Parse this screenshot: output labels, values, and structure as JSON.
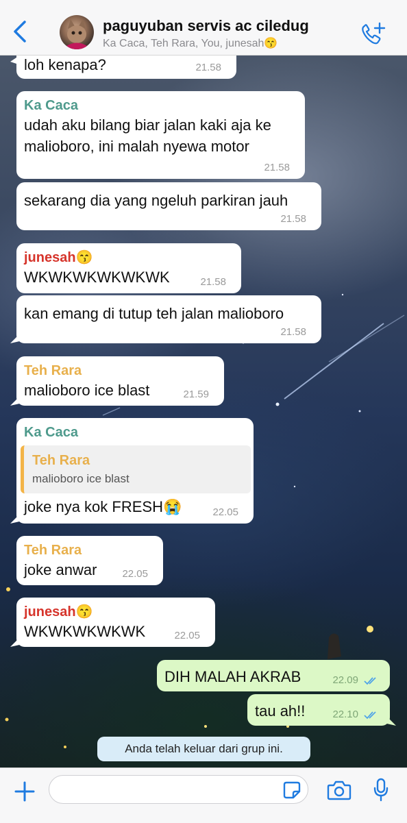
{
  "header": {
    "group_name": "paguyuban servis ac ciledug",
    "members": "Ka Caca, Teh Rara, You, junesah😙"
  },
  "colors": {
    "accent": "#1f7be0",
    "sender_ka_caca": "#4e9a8c",
    "sender_teh_rara": "#e8b04c",
    "sender_junesah": "#d6342b",
    "outgoing_bubble": "#dcf8c6"
  },
  "messages": [
    {
      "text": "loh kenapa?",
      "time": "21.58"
    },
    {
      "sender": "Ka Caca",
      "text": "udah aku bilang biar jalan kaki aja ke malioboro, ini malah nyewa motor",
      "time": "21.58"
    },
    {
      "text": "sekarang dia yang ngeluh parkiran jauh",
      "time": "21.58"
    },
    {
      "sender": "junesah😙",
      "text": "WKWKWKWKWKWK",
      "time": "21.58"
    },
    {
      "text": "kan emang di tutup teh jalan malioboro",
      "time": "21.58"
    },
    {
      "sender": "Teh Rara",
      "text": "malioboro ice blast",
      "time": "21.59"
    },
    {
      "sender": "Ka Caca",
      "quote_sender": "Teh Rara",
      "quote_text": "malioboro ice blast",
      "text": "joke nya kok FRESH😭",
      "time": "22.05"
    },
    {
      "sender": "Teh Rara",
      "text": "joke anwar",
      "time": "22.05"
    },
    {
      "sender": "junesah😙",
      "text": "WKWKWKWKWK",
      "time": "22.05"
    },
    {
      "text": "DIH MALAH AKRAB",
      "time": "22.09",
      "status": "read"
    },
    {
      "text": "tau ah!!",
      "time": "22.10",
      "status": "read"
    }
  ],
  "system_notice": "Anda telah keluar dari grup ini.",
  "input": {
    "placeholder": "",
    "icons": [
      "plus-icon",
      "sticker-icon",
      "camera-icon",
      "microphone-icon"
    ]
  }
}
